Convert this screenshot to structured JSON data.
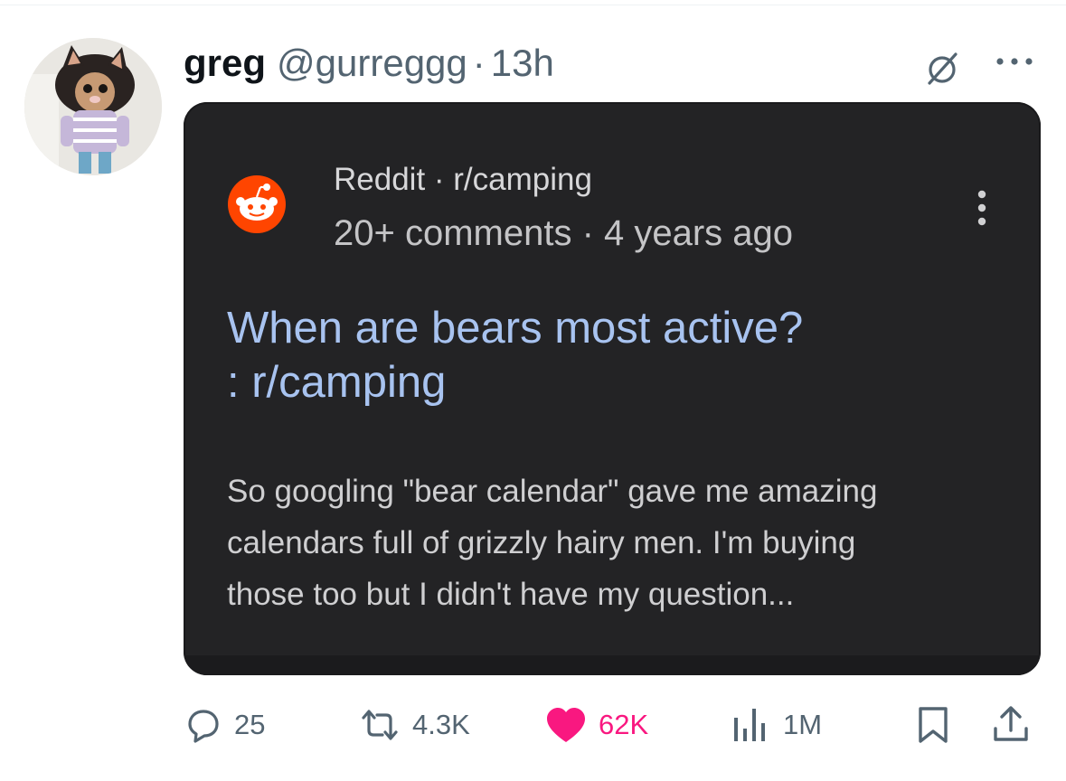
{
  "tweet": {
    "display_name": "greg",
    "handle": "@gurreggg",
    "separator": "·",
    "time": "13h",
    "icons": {
      "grok": "grok-icon",
      "more": "more-horizontal-icon",
      "avatar": "cat-costume-avatar"
    }
  },
  "embedded_post": {
    "source": "Reddit · r/camping",
    "meta": "20+ comments · 4 years ago",
    "title_line1": "When are bears most active?",
    "title_line2": ": r/camping",
    "snippet_line1": "So googling \"bear calendar\" gave me amazing",
    "snippet_line2": "calendars full of grizzly hairy men. I'm buying",
    "snippet_line3": "those too but I didn't have my question...",
    "colors": {
      "card_background": "#232325",
      "title": "#a8c3f0",
      "reddit_orange": "#ff4500"
    }
  },
  "actions": {
    "replies": "25",
    "reposts": "4.3K",
    "likes": "62K",
    "views": "1M",
    "liked": true,
    "colors": {
      "like": "#f91880",
      "muted": "#536471"
    }
  }
}
